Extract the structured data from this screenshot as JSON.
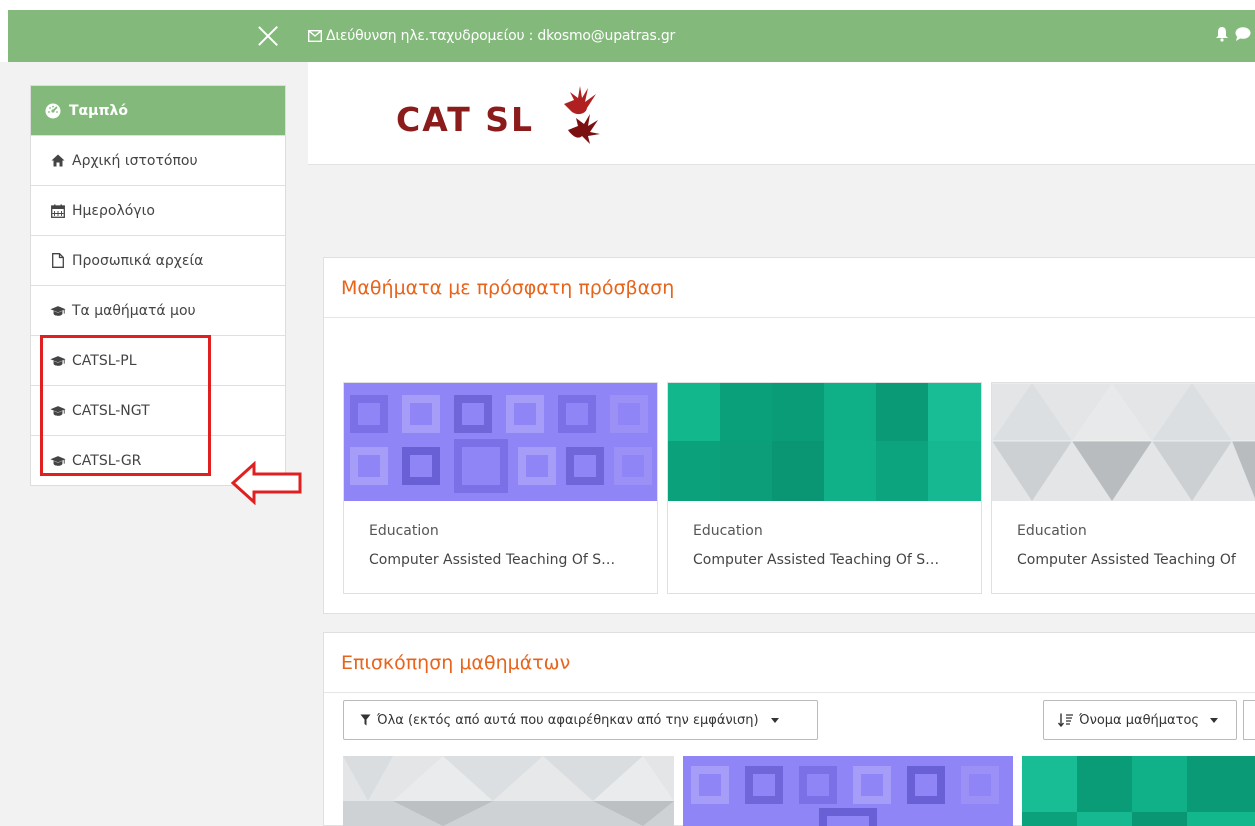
{
  "topbar": {
    "email_text": "Διεύθυνση ηλε.ταχυδρομείου : dkosmo@upatras.gr",
    "icons": [
      "close-icon",
      "envelope-icon",
      "bell-icon",
      "chat-icon"
    ]
  },
  "sidebar": {
    "header_label": "Ταμπλό",
    "items": [
      {
        "label": "Αρχική ιστοτόπου",
        "icon": "home-icon"
      },
      {
        "label": "Ημερολόγιο",
        "icon": "calendar-icon"
      },
      {
        "label": "Προσωπικά αρχεία",
        "icon": "file-icon"
      },
      {
        "label": "Τα μαθήματά μου",
        "icon": "graduation-cap-icon"
      },
      {
        "label": "CATSL-PL",
        "icon": "graduation-cap-icon"
      },
      {
        "label": "CATSL-NGT",
        "icon": "graduation-cap-icon"
      },
      {
        "label": "CATSL-GR",
        "icon": "graduation-cap-icon"
      }
    ]
  },
  "logo": {
    "text": "CAT SL"
  },
  "recent": {
    "title": "Μαθήματα με πρόσφατη πρόσβαση",
    "courses": [
      {
        "category": "Education",
        "name": "Computer Assisted Teaching Of S…",
        "pattern": "purple-squares"
      },
      {
        "category": "Education",
        "name": "Computer Assisted Teaching Of S…",
        "pattern": "green-blocks"
      },
      {
        "category": "Education",
        "name": "Computer Assisted Teaching Of",
        "pattern": "grey-triangles"
      }
    ]
  },
  "overview": {
    "title": "Επισκόπηση μαθημάτων",
    "filter_label": "Όλα (εκτός από αυτά που αφαιρέθηκαν από την εμφάνιση)",
    "sort_label": "Όνομα μαθήματος"
  },
  "colors": {
    "brand_green": "#83b97b",
    "heading_orange": "#e8641b",
    "highlight_red": "#e02020",
    "logo_red": "#8b1c1c"
  }
}
